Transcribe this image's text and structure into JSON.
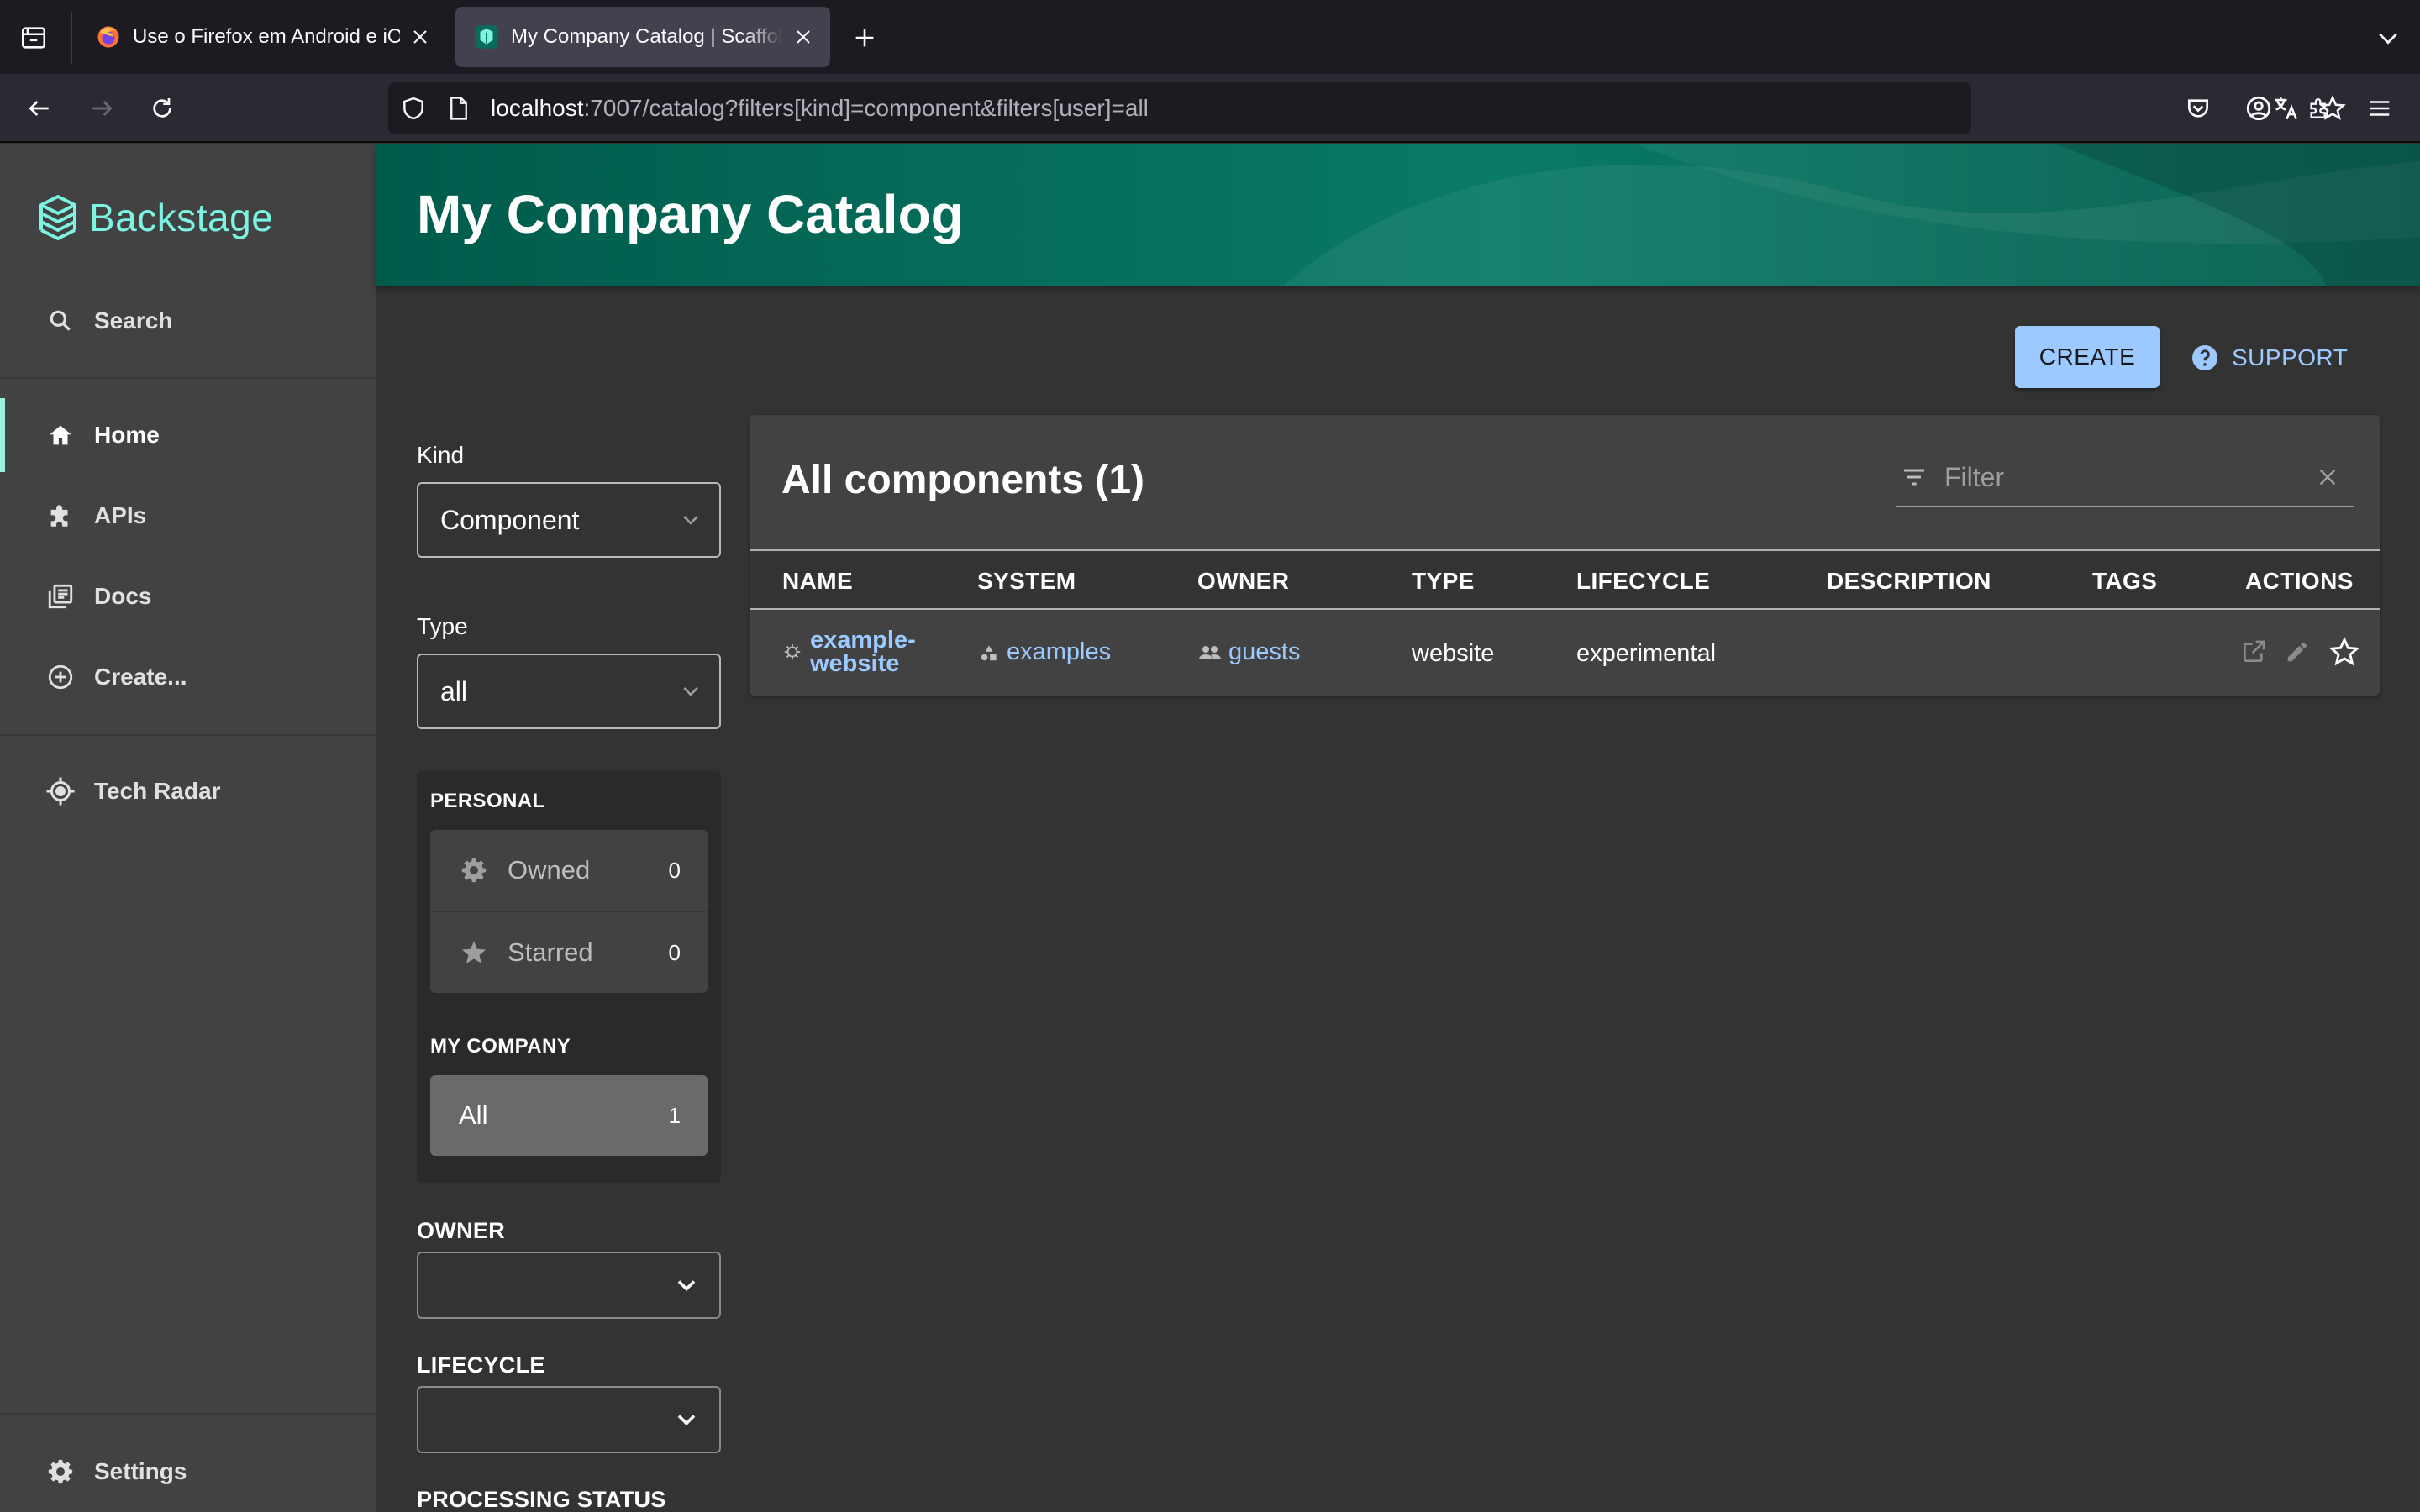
{
  "browser": {
    "tabs": [
      {
        "title": "Use o Firefox em Android e iOS",
        "active": false
      },
      {
        "title": "My Company Catalog | Scaffolder",
        "active": true
      }
    ],
    "url": {
      "host": "localhost",
      "rest": ":7007/catalog?filters[kind]=component&filters[user]=all"
    }
  },
  "app": {
    "logo_text": "Backstage",
    "nav": {
      "search": "Search",
      "home": "Home",
      "apis": "APIs",
      "docs": "Docs",
      "create": "Create...",
      "tech_radar": "Tech Radar",
      "settings": "Settings"
    },
    "active_nav": "home"
  },
  "header": {
    "title": "My Company Catalog"
  },
  "actions": {
    "create": "CREATE",
    "support": "SUPPORT"
  },
  "filters": {
    "kind_label": "Kind",
    "kind_value": "Component",
    "type_label": "Type",
    "type_value": "all",
    "personal_heading": "PERSONAL",
    "owned_label": "Owned",
    "owned_count": "0",
    "starred_label": "Starred",
    "starred_count": "0",
    "company_heading": "MY COMPANY",
    "all_label": "All",
    "all_count": "1",
    "owner_label": "OWNER",
    "lifecycle_label": "LIFECYCLE",
    "processing_label": "PROCESSING STATUS"
  },
  "table": {
    "title": "All components (1)",
    "filter_placeholder": "Filter",
    "columns": [
      "NAME",
      "SYSTEM",
      "OWNER",
      "TYPE",
      "LIFECYCLE",
      "DESCRIPTION",
      "TAGS",
      "ACTIONS"
    ],
    "rows": [
      {
        "name_line1": "example-",
        "name_line2": "website",
        "system": "examples",
        "owner": "guests",
        "type": "website",
        "lifecycle": "experimental",
        "description": "",
        "tags": ""
      }
    ]
  },
  "colors": {
    "accent_teal": "#7df3e1",
    "link_blue": "#9cc9ff",
    "header_green": "#005b4b",
    "sidebar_bg": "#424242",
    "content_bg": "#333333"
  }
}
